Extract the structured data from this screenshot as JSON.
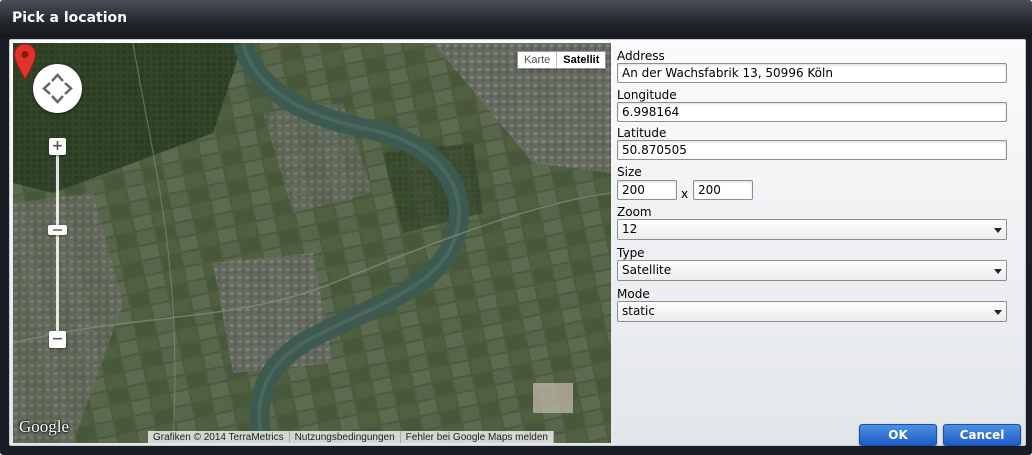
{
  "dialog": {
    "title": "Pick a location"
  },
  "map": {
    "type_karte": "Karte",
    "type_satellite": "Satellit",
    "google_logo": "Google",
    "attribution": [
      "Grafiken © 2014 TerraMetrics",
      "Nutzungsbedingungen",
      "Fehler bei Google Maps melden"
    ],
    "zoom_plus": "+",
    "zoom_minus": "−"
  },
  "form": {
    "address": {
      "label": "Address",
      "value": "An der Wachsfabrik 13, 50996 Köln"
    },
    "longitude": {
      "label": "Longitude",
      "value": "6.998164"
    },
    "latitude": {
      "label": "Latitude",
      "value": "50.870505"
    },
    "size": {
      "label": "Size",
      "width": "200",
      "separator": "x",
      "height": "200"
    },
    "zoom": {
      "label": "Zoom",
      "value": "12"
    },
    "type": {
      "label": "Type",
      "value": "Satellite"
    },
    "mode": {
      "label": "Mode",
      "value": "static"
    }
  },
  "buttons": {
    "ok": "OK",
    "cancel": "Cancel"
  },
  "colors": {
    "accent": "#1d5cc6",
    "marker": "#e0332b",
    "river": "#3c5a50"
  }
}
